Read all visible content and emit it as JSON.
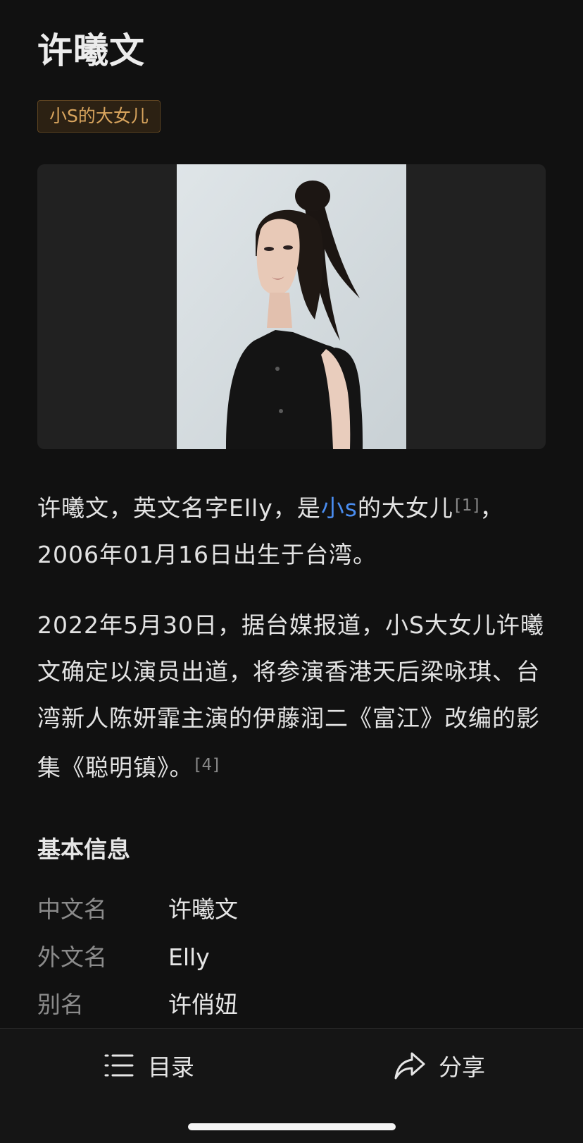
{
  "article": {
    "title": "许曦文",
    "tag": "小S的大女儿"
  },
  "intro": {
    "p1_a": "许曦文，英文名字Elly，是",
    "p1_link": "小s",
    "p1_b": "的大女儿",
    "p1_ref": "[1]",
    "p1_c": "，2006年01月16日出生于台湾。",
    "p2_a": "2022年5月30日，据台媒报道，小S大女儿许曦文确定以演员出道，将参演香港天后梁咏琪、台湾新人陈妍霏主演的伊藤润二《富江》改编的影集《聪明镇》。",
    "p2_ref": "[4]"
  },
  "basic_info": {
    "section_title": "基本信息",
    "rows": [
      {
        "key": "中文名",
        "value": "许曦文"
      },
      {
        "key": "外文名",
        "value": "Elly"
      },
      {
        "key": "别名",
        "value": "许俏妞"
      }
    ]
  },
  "bottom_bar": {
    "toc_label": "目录",
    "toc_icon": "list-icon",
    "share_label": "分享",
    "share_icon": "share-arrow-icon"
  },
  "colors": {
    "background": "#111111",
    "link": "#4a8df0",
    "tag_text": "#d9a55e",
    "tag_bg": "#2c2113",
    "muted": "#8b8b8b"
  }
}
